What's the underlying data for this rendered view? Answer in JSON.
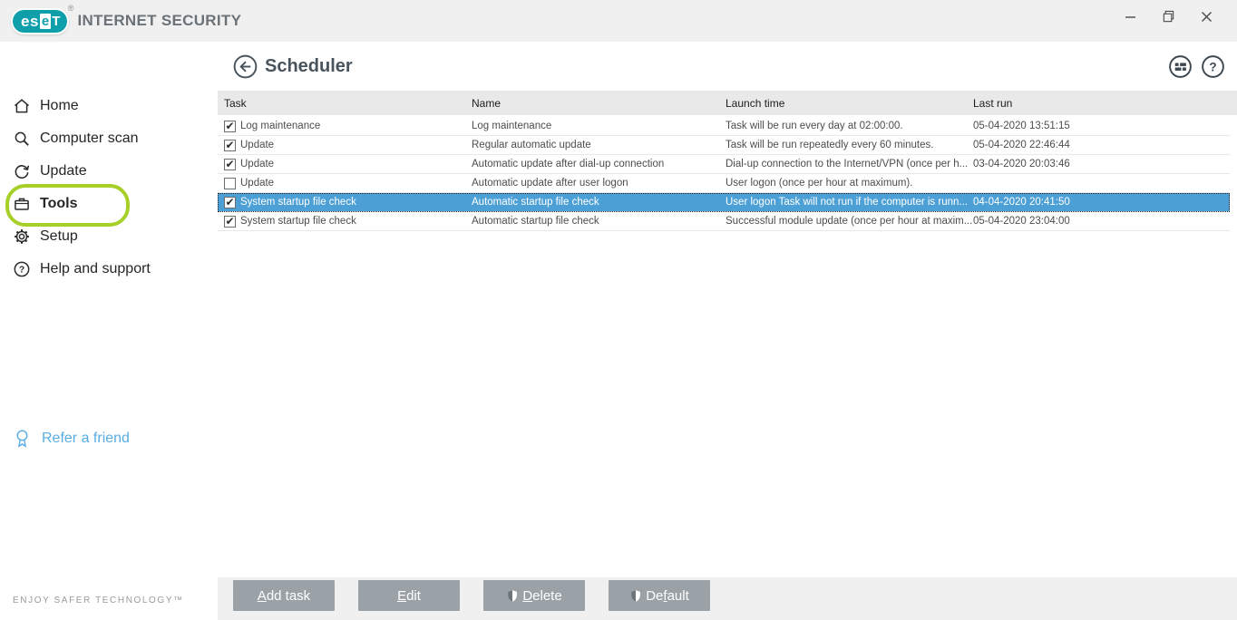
{
  "brand": {
    "logo_es": "es",
    "logo_e": "e",
    "logo_t": "T",
    "reg": "®",
    "product": "INTERNET SECURITY"
  },
  "icons": {
    "check": "✔",
    "help": "?"
  },
  "sidebar": {
    "items": [
      {
        "label": "Home",
        "icon": "home",
        "active": false
      },
      {
        "label": "Computer scan",
        "icon": "scan",
        "active": false
      },
      {
        "label": "Update",
        "icon": "update",
        "active": false
      },
      {
        "label": "Tools",
        "icon": "tools",
        "active": true,
        "annotated": true
      },
      {
        "label": "Setup",
        "icon": "setup",
        "active": false
      },
      {
        "label": "Help and support",
        "icon": "help",
        "active": false
      }
    ],
    "refer_label": "Refer a friend",
    "tagline": "ENJOY SAFER TECHNOLOGY™"
  },
  "header": {
    "title": "Scheduler"
  },
  "table": {
    "columns": [
      "Task",
      "Name",
      "Launch time",
      "Last run"
    ],
    "rows": [
      {
        "checked": true,
        "selected": false,
        "task": "Log maintenance",
        "name": "Log maintenance",
        "launch": "Task will be run every day at 02:00:00.",
        "last_run": "05-04-2020 13:51:15"
      },
      {
        "checked": true,
        "selected": false,
        "task": "Update",
        "name": "Regular automatic update",
        "launch": "Task will be run repeatedly every 60 minutes.",
        "last_run": "05-04-2020 22:46:44"
      },
      {
        "checked": true,
        "selected": false,
        "task": "Update",
        "name": "Automatic update after dial-up connection",
        "launch": "Dial-up connection to the Internet/VPN (once per h...",
        "last_run": "03-04-2020 20:03:46"
      },
      {
        "checked": false,
        "selected": false,
        "task": "Update",
        "name": "Automatic update after user logon",
        "launch": "User logon (once per hour at maximum).",
        "last_run": ""
      },
      {
        "checked": true,
        "selected": true,
        "task": "System startup file check",
        "name": "Automatic startup file check",
        "launch": "User logon Task will not run if the computer is runn...",
        "last_run": "04-04-2020 20:41:50"
      },
      {
        "checked": true,
        "selected": false,
        "task": "System startup file check",
        "name": "Automatic startup file check",
        "launch": "Successful module update (once per hour at maxim...",
        "last_run": "05-04-2020 23:04:00"
      }
    ]
  },
  "buttons": [
    {
      "name": "add-task-button",
      "pre": "",
      "key": "A",
      "post": "dd task",
      "shield": false
    },
    {
      "name": "edit-button",
      "pre": "",
      "key": "E",
      "post": "dit",
      "shield": false
    },
    {
      "name": "delete-button",
      "pre": "",
      "key": "D",
      "post": "elete",
      "shield": true
    },
    {
      "name": "default-button",
      "pre": "De",
      "key": "f",
      "post": "ault",
      "shield": true
    }
  ],
  "colors": {
    "accent_teal": "#0f9fab",
    "selection_blue": "#4da0d6",
    "annotation_green": "#a6d028",
    "refer_blue": "#58ade2",
    "button_gray": "#9aa1a7"
  }
}
